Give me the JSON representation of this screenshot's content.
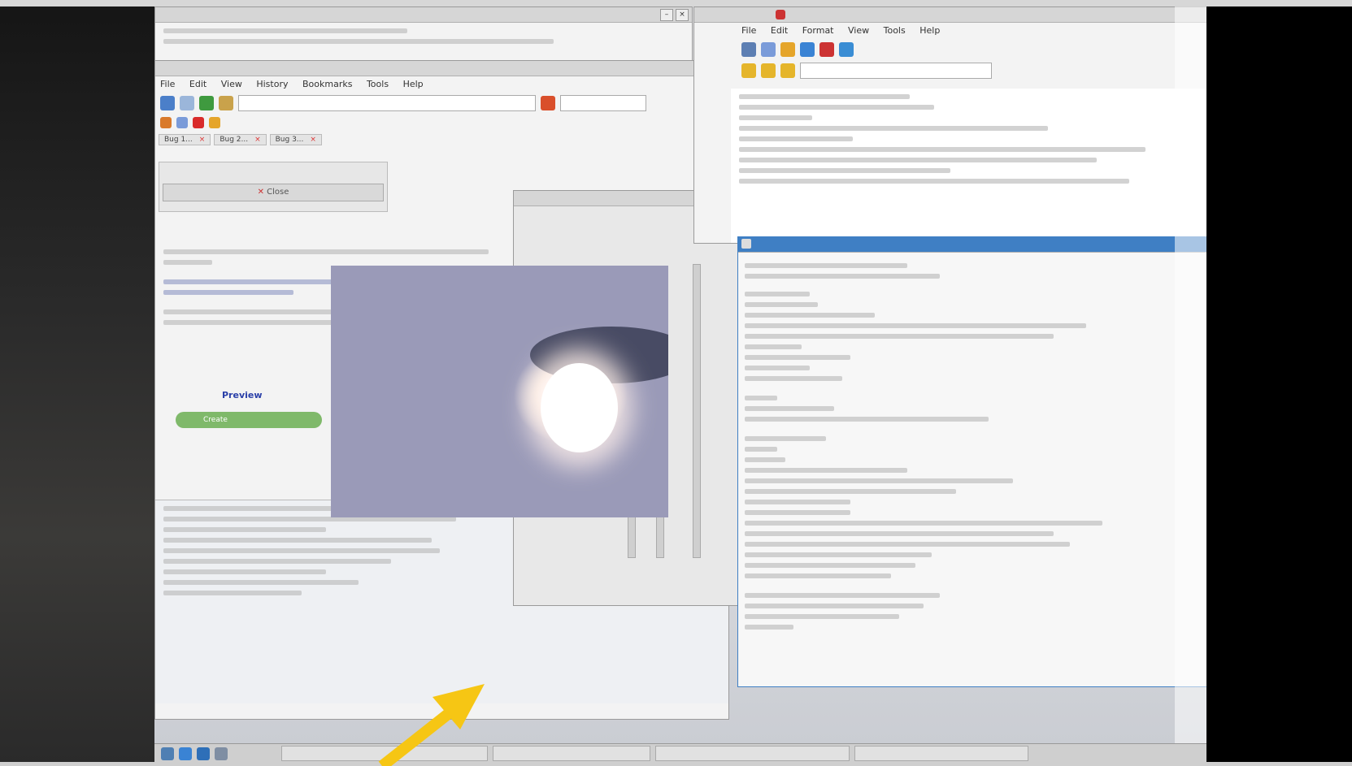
{
  "firefox": {
    "menu": [
      "File",
      "Edit",
      "View",
      "History",
      "Bookmarks",
      "Tools",
      "Help"
    ],
    "tabs": [
      {
        "label": "Bug 1..."
      },
      {
        "label": "Bug 2..."
      },
      {
        "label": "Bug 3..."
      }
    ]
  },
  "editor": {
    "menu": [
      "File",
      "Edit",
      "Format",
      "View",
      "Tools",
      "Help"
    ]
  },
  "page": {
    "link": "Preview",
    "green_button": "Create"
  },
  "dialog": {
    "button": "Close"
  },
  "colors": {
    "arrow": "#f6c614",
    "active_title": "#3f7fc4"
  },
  "icons": [
    "back-icon",
    "forward-icon",
    "reload-icon",
    "home-icon",
    "star-icon",
    "close-icon"
  ]
}
